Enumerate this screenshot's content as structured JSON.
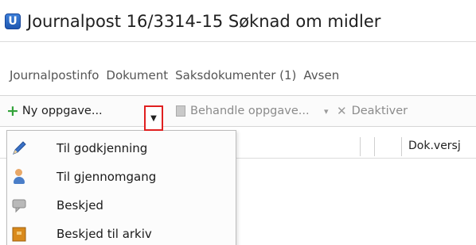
{
  "window": {
    "app_icon_letter": "U",
    "title": "Journalpost 16/3314-15 Søknad om midler"
  },
  "tabs": [
    "Journalpostinfo",
    "Dokument",
    "Saksdokumenter (1)",
    "Avsen"
  ],
  "toolbar": {
    "new_task_label": "Ny oppgave...",
    "process_task_label": "Behandle oppgave...",
    "deactivate_label": "Deaktiver"
  },
  "grid": {
    "visible_column_header": "Dok.versj"
  },
  "menu": {
    "items": [
      {
        "label": "Til godkjenning",
        "icon": "pencil-icon"
      },
      {
        "label": "Til gjennomgang",
        "icon": "person-icon"
      },
      {
        "label": "Beskjed",
        "icon": "speech-bubble-icon"
      },
      {
        "label": "Beskjed til arkiv",
        "icon": "archive-icon"
      }
    ]
  },
  "colors": {
    "highlight_border": "#e02020",
    "add_icon": "#33a33a",
    "app_icon": "#2a67c4"
  }
}
